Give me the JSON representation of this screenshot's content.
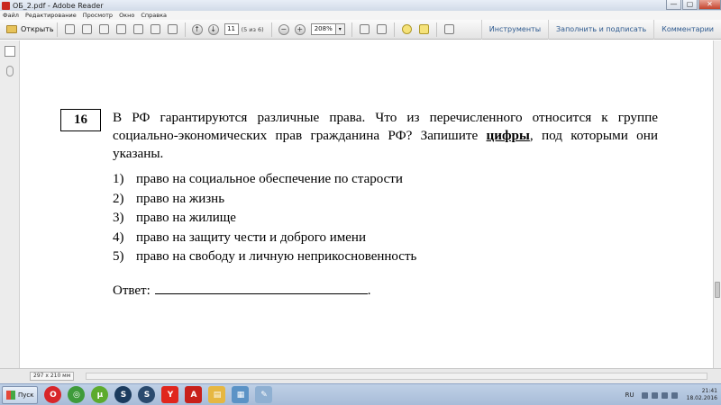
{
  "window": {
    "title": "ОБ_2.pdf - Adobe Reader",
    "minimize": "—",
    "maximize": "▢",
    "close": "✕"
  },
  "menu": [
    "Файл",
    "Редактирование",
    "Просмотр",
    "Окно",
    "Справка"
  ],
  "toolbar": {
    "open_label": "Открыть",
    "page_current": "11",
    "page_count": "(5 из 6)",
    "zoom": "208%",
    "tools_label": "Инструменты",
    "fill_sign_label": "Заполнить и подписать",
    "comments_label": "Комментарии"
  },
  "document": {
    "question_number": "16",
    "question_text_before": "В РФ гарантируются различные права. Что из перечисленного относится к группе социально-экономических прав гражданина РФ? Запишите ",
    "question_text_emph": "цифры",
    "question_text_after": ", под которыми они указаны.",
    "options": [
      {
        "num": "1)",
        "text": "право на социальное обеспечение по старости"
      },
      {
        "num": "2)",
        "text": "право на жизнь"
      },
      {
        "num": "3)",
        "text": "право на жилище"
      },
      {
        "num": "4)",
        "text": "право на защиту чести и доброго имени"
      },
      {
        "num": "5)",
        "text": "право на свободу и личную неприкосновенность"
      }
    ],
    "answer_label": "Ответ:",
    "answer_suffix": "."
  },
  "status": {
    "page_size": "297 x 210 мм"
  },
  "taskbar": {
    "start_label": "Пуск",
    "apps": [
      {
        "name": "opera-icon",
        "color": "#d8262a",
        "glyph": "O"
      },
      {
        "name": "chrome-icon",
        "color": "#3f9b3b",
        "glyph": "◎"
      },
      {
        "name": "utorrent-icon",
        "color": "#5cab2d",
        "glyph": "µ"
      },
      {
        "name": "steam-icon",
        "color": "#1b3b5e",
        "glyph": "S"
      },
      {
        "name": "steam-app-icon",
        "color": "#2a4a6e",
        "glyph": "S"
      },
      {
        "name": "yandex-browser-icon",
        "color": "#e0261d",
        "glyph": "Y"
      },
      {
        "name": "adobe-reader-icon",
        "color": "#c8201a",
        "glyph": "A"
      },
      {
        "name": "folder-icon",
        "color": "#e6b742",
        "glyph": "▤"
      },
      {
        "name": "notes-icon",
        "color": "#5b93c6",
        "glyph": "▦"
      },
      {
        "name": "paint-icon",
        "color": "#8fb0d2",
        "glyph": "✎"
      }
    ],
    "language": "RU",
    "time": "21:41",
    "date": "18.02.2016"
  }
}
